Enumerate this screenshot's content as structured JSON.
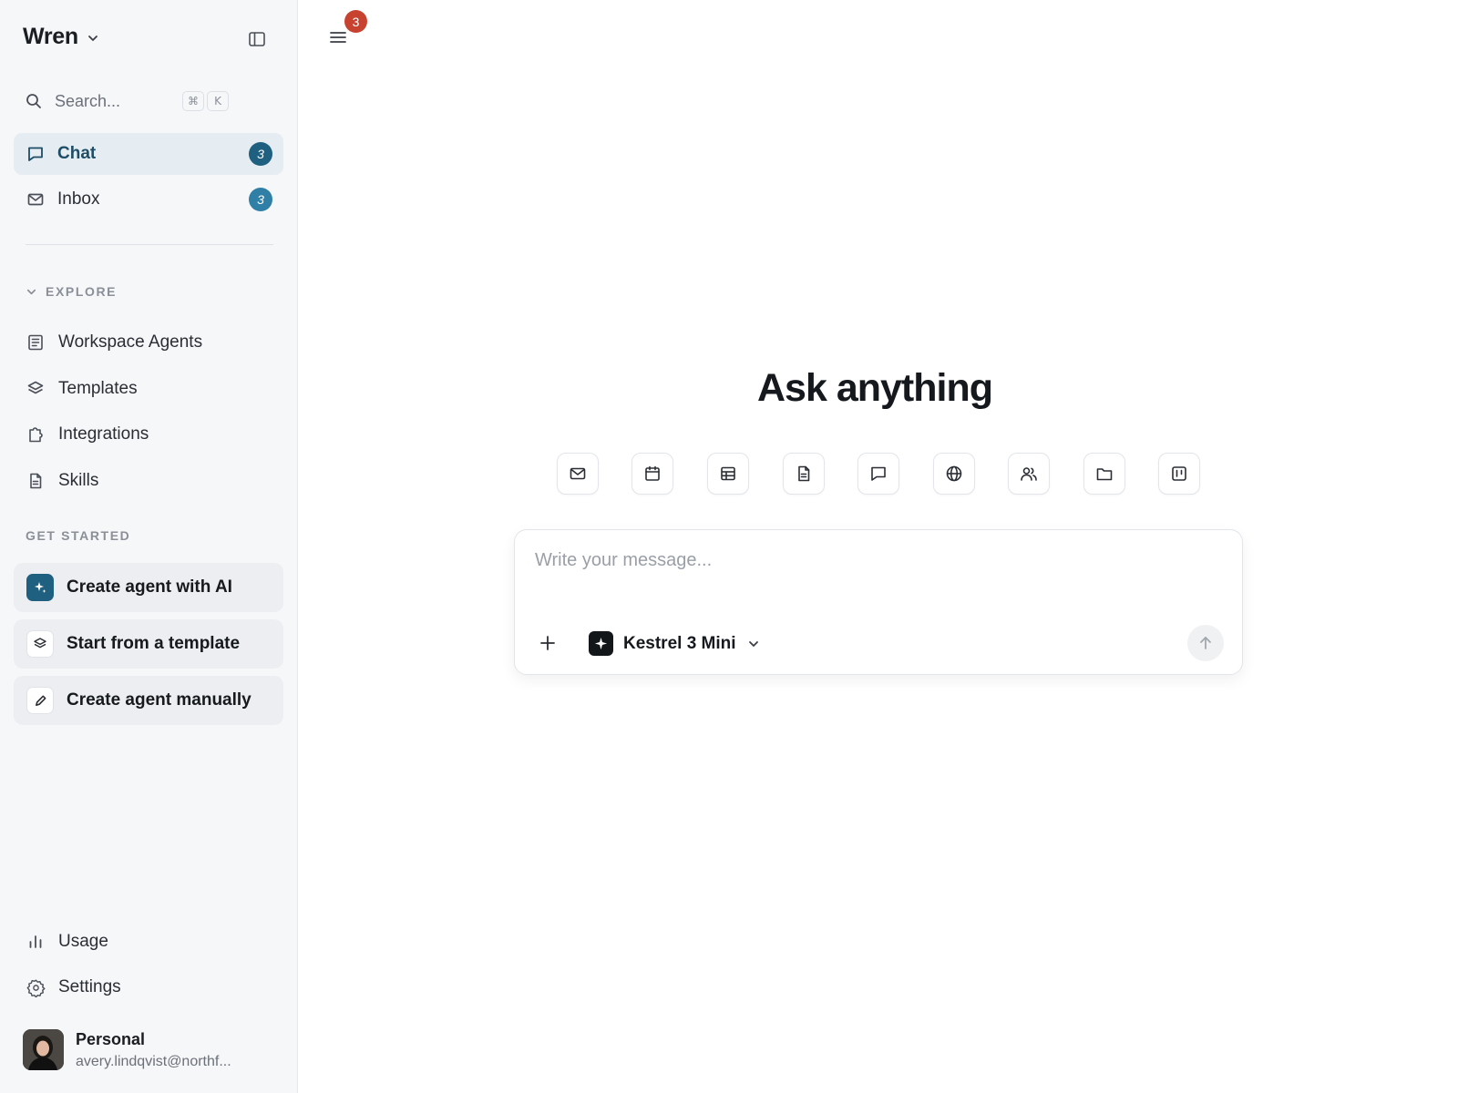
{
  "sidebar": {
    "brand": "Wren",
    "search": {
      "placeholder": "Search...",
      "shortcut_key1": "⌘",
      "shortcut_key2": "K"
    },
    "nav": [
      {
        "label": "Chat",
        "badge": "3",
        "icon": "chat-bubble-icon",
        "active": true
      },
      {
        "label": "Inbox",
        "badge": "3",
        "icon": "mail-icon",
        "active": false
      }
    ],
    "explore_title": "EXPLORE",
    "explore": [
      {
        "label": "Workspace Agents",
        "icon": "agents-icon"
      },
      {
        "label": "Templates",
        "icon": "layers-icon"
      },
      {
        "label": "Integrations",
        "icon": "puzzle-icon"
      },
      {
        "label": "Skills",
        "icon": "document-icon"
      }
    ],
    "get_started_title": "GET STARTED",
    "get_started": [
      {
        "label": "Create agent with AI",
        "icon": "sparkle-icon"
      },
      {
        "label": "Start from a template",
        "icon": "layers-icon"
      },
      {
        "label": "Create agent manually",
        "icon": "pencil-icon"
      }
    ],
    "bottom": [
      {
        "label": "Usage",
        "icon": "bar-chart-icon"
      },
      {
        "label": "Settings",
        "icon": "gear-icon"
      }
    ],
    "profile": {
      "name": "Personal",
      "email": "avery.lindqvist@northf..."
    }
  },
  "main": {
    "menu_badge": "3",
    "title": "Ask anything",
    "quick_actions": [
      "mail-icon",
      "calendar-icon",
      "table-icon",
      "document-icon",
      "chat-icon",
      "globe-icon",
      "users-icon",
      "folder-icon",
      "board-icon"
    ],
    "composer": {
      "placeholder": "Write your message...",
      "model": "Kestrel 3 Mini"
    }
  },
  "colors": {
    "accent": "#1f5f80",
    "active_bg": "#e6edf2",
    "sidebar_bg": "#f6f7f9",
    "notification": "#c8432f"
  }
}
